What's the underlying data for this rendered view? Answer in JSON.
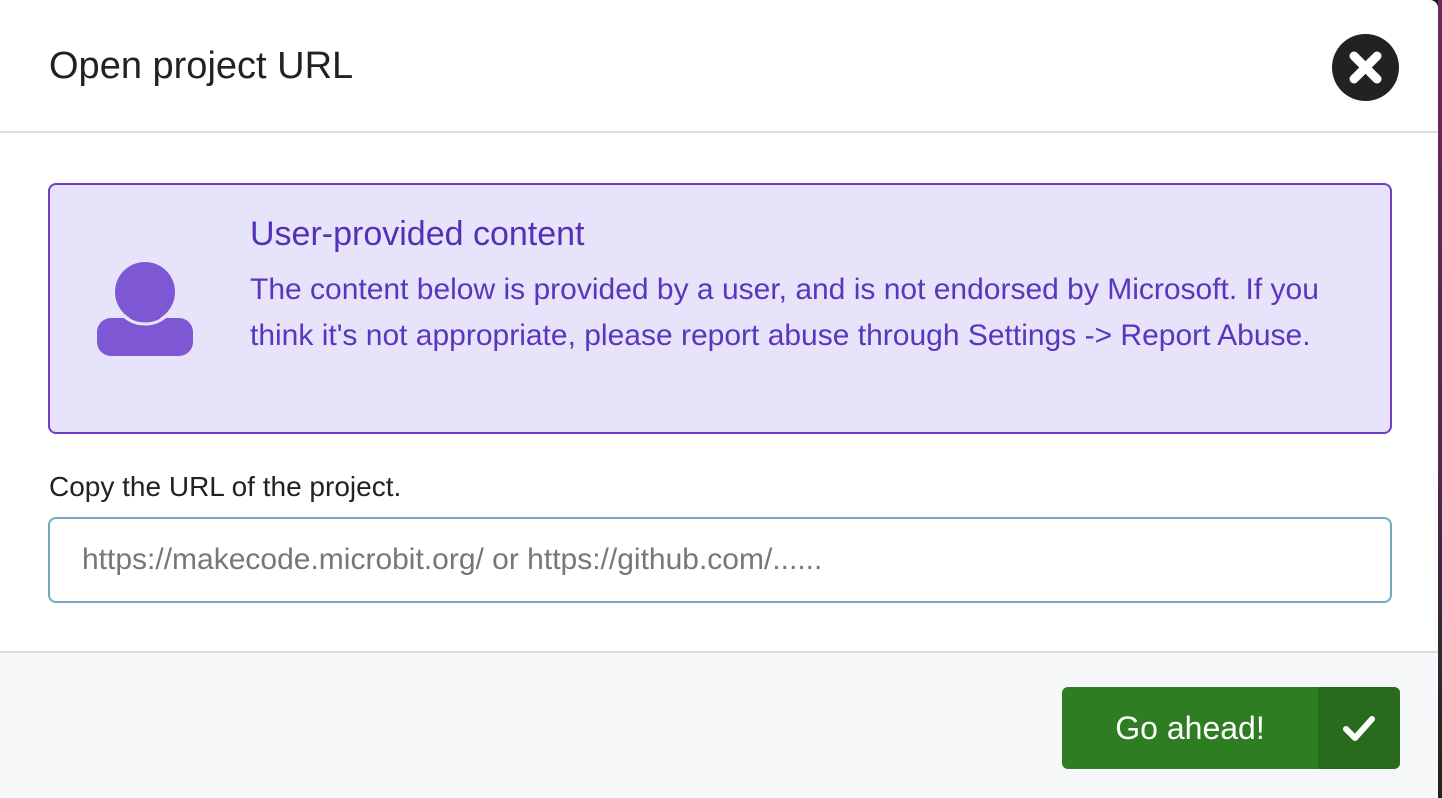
{
  "dialog": {
    "title": "Open project URL",
    "close_icon": "close-icon"
  },
  "notice": {
    "icon": "user-icon",
    "heading": "User-provided content",
    "text": "The content below is provided by a user, and is not endorsed by Microsoft. If you think it's not appropriate, please report abuse through Settings -> Report Abuse.",
    "color": "#5330b8",
    "background": "#e6e3fb",
    "border_color": "#6e40c9"
  },
  "url_field": {
    "label": "Copy the URL of the project.",
    "placeholder": "https://makecode.microbit.org/ or https://github.com/......",
    "value": ""
  },
  "footer": {
    "go_button_label": "Go ahead!",
    "go_button_icon": "checkmark-icon",
    "go_button_color": "#2f7d22"
  }
}
